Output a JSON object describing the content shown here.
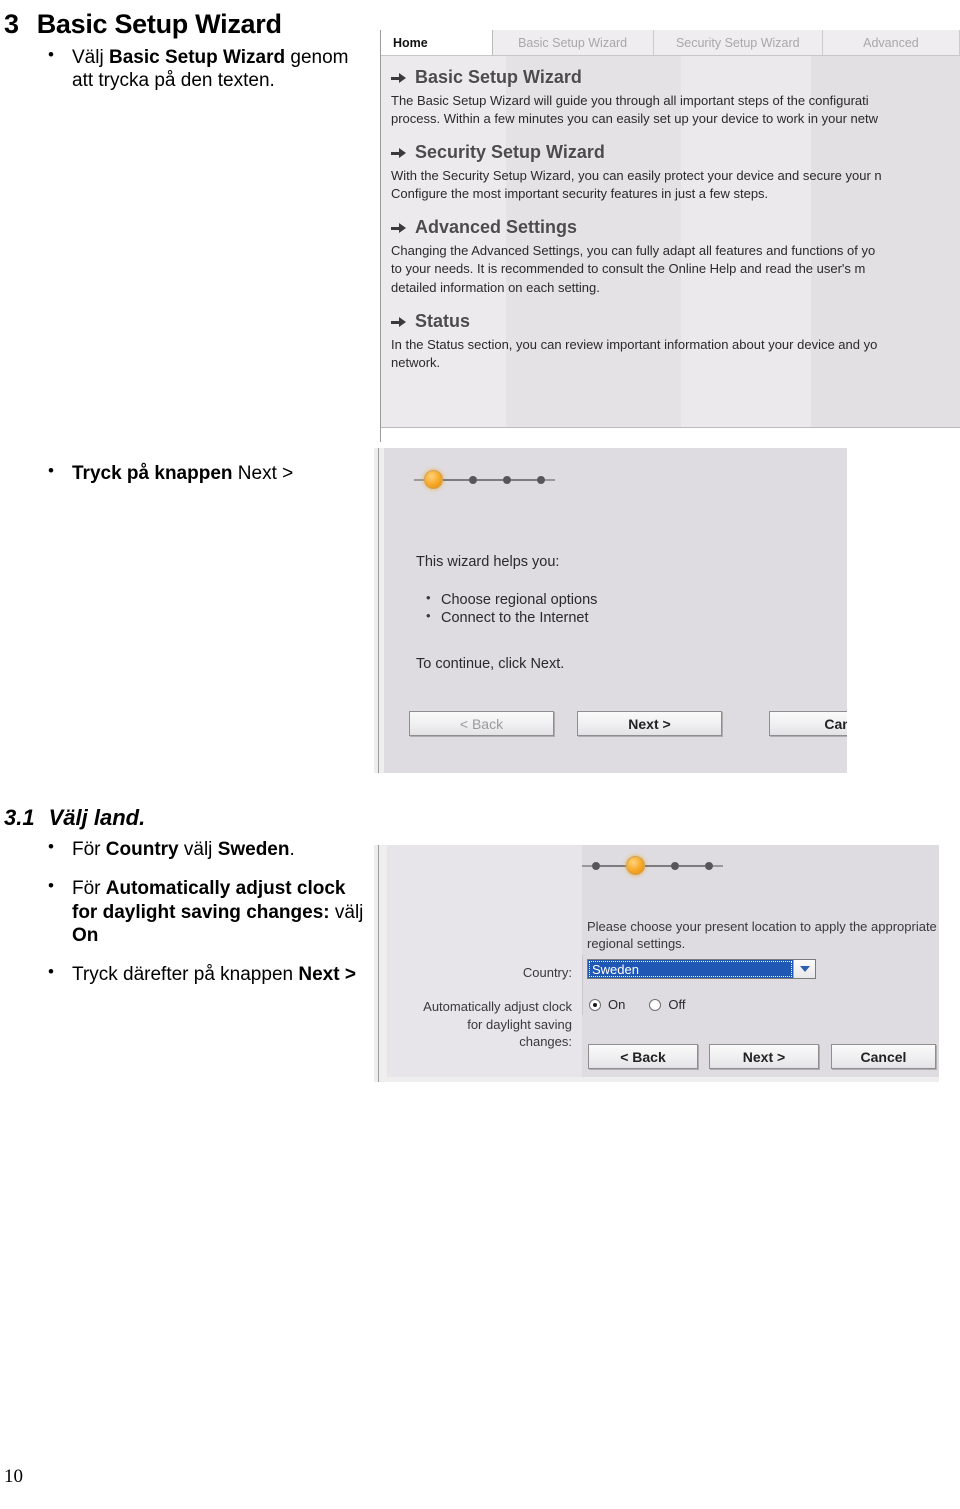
{
  "document": {
    "heading_number": "3",
    "heading_title": "Basic Setup Wizard",
    "bullet_1": {
      "t1": "Välj ",
      "t2": "Basic Setup Wizard",
      "t3": " genom att trycka på den texten."
    },
    "bullet_2": {
      "t1": "Tryck på knappen",
      "t2": " Next >"
    },
    "sub_heading_number": "3.1",
    "sub_heading_title": "Välj land.",
    "bullet_3": {
      "t1": "För ",
      "t2": "Country",
      "t3": " välj ",
      "t4": "Sweden",
      "t5": "."
    },
    "bullet_4": {
      "t1": "För ",
      "t2": "Automatically adjust clock for daylight saving changes:",
      "t3": " välj ",
      "t4": "On"
    },
    "bullet_5": {
      "t1": "Tryck därefter på knappen ",
      "t2": "Next >"
    },
    "page_number": "10"
  },
  "screenshot_home": {
    "tabs": [
      {
        "label": "Home",
        "active": true
      },
      {
        "label": "Basic Setup Wizard",
        "active": false
      },
      {
        "label": "Security Setup Wizard",
        "active": false
      },
      {
        "label": "Advanced",
        "active": false
      }
    ],
    "sections": [
      {
        "title": "Basic Setup Wizard",
        "lines": [
          "The Basic Setup Wizard will guide you through all important steps of the configurati",
          "process. Within a few minutes you can easily set up your device to work in your netw"
        ]
      },
      {
        "title": "Security Setup Wizard",
        "lines": [
          "With the Security Setup Wizard, you can easily protect your device and secure your n",
          "Configure the most important security features in just a few steps."
        ]
      },
      {
        "title": "Advanced Settings",
        "lines": [
          "Changing the Advanced Settings, you can fully adapt all features and functions of yo",
          "to your needs. It is recommended to consult the Online Help and read the user's m",
          "detailed information on each setting."
        ]
      },
      {
        "title": "Status",
        "lines": [
          "In the Status section, you can review important information about your device and yo",
          "network."
        ]
      }
    ]
  },
  "screenshot_wizard_intro": {
    "step_current": 1,
    "step_total": 4,
    "intro_text": "This wizard helps you:",
    "help_items": [
      "Choose regional options",
      "Connect to the Internet"
    ],
    "continue_text": "To continue, click Next.",
    "buttons": {
      "back": "< Back",
      "next": "Next >",
      "cancel": "Canc"
    }
  },
  "screenshot_country": {
    "step_current": 2,
    "step_total": 4,
    "instruction_lines": [
      "Please choose your present location to apply the appropriate",
      "regional settings."
    ],
    "country_label": "Country:",
    "country_value": "Sweden",
    "daylight_label_line1": "Automatically adjust clock",
    "daylight_label_line2": "for daylight saving changes:",
    "radio_on": "On",
    "radio_off": "Off",
    "radio_selected": "On",
    "buttons": {
      "back": "< Back",
      "next": "Next >",
      "cancel": "Cancel"
    }
  },
  "colors": {
    "accent_orange": "#f5a623",
    "select_highlight": "#1f57b5",
    "panel_gray": "#dedce0"
  }
}
